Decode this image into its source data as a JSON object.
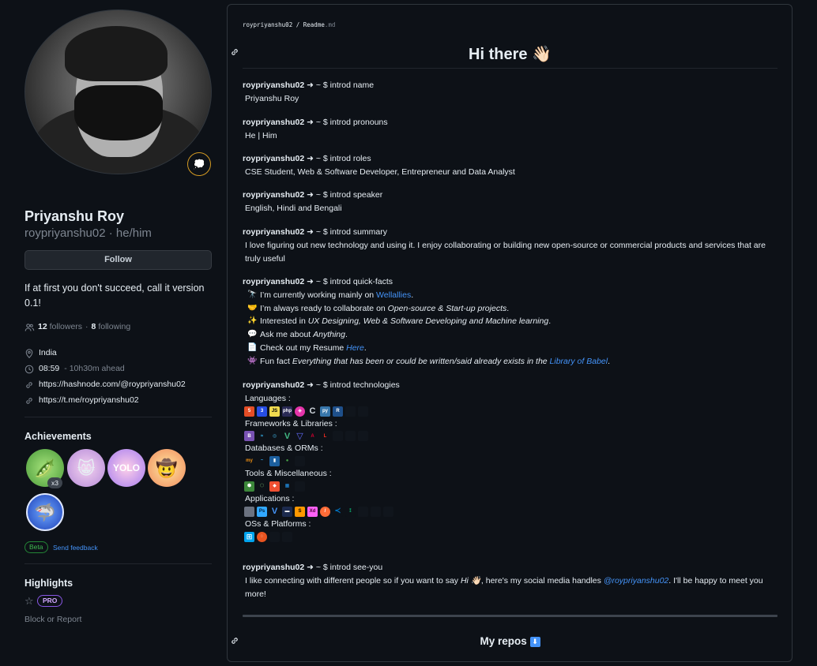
{
  "profile": {
    "name": "Priyanshu Roy",
    "login": "roypriyanshu02",
    "pronouns": "he/him",
    "login_line": "roypriyanshu02 · he/him",
    "follow_label": "Follow",
    "status_emoji": "💭",
    "bio": "If at first you don't succeed, call it version 0.1!",
    "followers_count": "12",
    "followers_label": "followers",
    "following_count": "8",
    "following_label": "following",
    "location": "India",
    "local_time": "08:59",
    "time_note": "- 10h30m ahead",
    "links": [
      "https://hashnode.com/@roypriyanshu02",
      "https://t.me/roypriyanshu02"
    ]
  },
  "achievements": {
    "title": "Achievements",
    "count_badge": "x3",
    "beta_label": "Beta",
    "feedback_label": "Send feedback",
    "badges": [
      "pair-extraordinaire",
      "quickdraw",
      "yolo",
      "starstruck",
      "pull-shark"
    ]
  },
  "highlights": {
    "title": "Highlights",
    "pro_label": "PRO",
    "block_label": "Block or Report"
  },
  "readme": {
    "breadcrumb_repo": "roypriyanshu02",
    "breadcrumb_sep": "/",
    "breadcrumb_file": "Readme",
    "breadcrumb_ext": ".md",
    "heading": "Hi there 👋🏻",
    "prompt_user": "roypriyanshu02",
    "prompt_rest": " ➜ ~ $ ",
    "cmd_name": "introd name",
    "out_name": "Priyanshu Roy",
    "cmd_pronouns": "introd pronouns",
    "out_pronouns": "He | Him",
    "cmd_roles": "introd roles",
    "out_roles": "CSE Student, Web & Software Developer, Entrepreneur and Data Analyst",
    "cmd_speaker": "introd speaker",
    "out_speaker": "English, Hindi and Bengali",
    "cmd_summary": "introd summary",
    "out_summary": "I love figuring out new technology and using it. I enjoy collaborating or building new open-source or commercial products and services that are truly useful",
    "cmd_facts": "introd quick-facts",
    "facts": [
      {
        "emoji": "🔭",
        "pre": "I’m currently working mainly on ",
        "link": "Wellallies",
        "em": "",
        "post": "."
      },
      {
        "emoji": "🤝",
        "pre": "I’m always ready to collaborate on ",
        "link": "",
        "em": "Open-source & Start-up projects",
        "post": "."
      },
      {
        "emoji": "✨",
        "pre": "Interested in ",
        "link": "",
        "em": "UX Designing, Web & Software Developing and Machine learning",
        "post": "."
      },
      {
        "emoji": "💬",
        "pre": "Ask me about ",
        "link": "",
        "em": "Anything",
        "post": "."
      },
      {
        "emoji": "📄",
        "pre": "Check out my Resume ",
        "link": "Here",
        "em": "",
        "post": "."
      },
      {
        "emoji": "👾",
        "pre": "Fun fact ",
        "link": "",
        "em": "Everything that has been or could be written/said already exists in the ",
        "post": "."
      }
    ],
    "fact_last_link": "Library of Babel",
    "cmd_tech": "introd technologies",
    "tech_categories": [
      "Languages :",
      "Frameworks & Libraries :",
      "Databases & ORMs :",
      "Tools & Miscellaneous :",
      "Applications :",
      "OSs & Platforms :"
    ],
    "cmd_seeyou": "introd see-you",
    "seeyou_pre": "I like connecting with different people so if you want to say ",
    "seeyou_hi": "Hi 👋🏻",
    "seeyou_mid": ", here's my social media handles ",
    "seeyou_link": "@roypriyanshu02",
    "seeyou_post": ". I'll be happy to meet you more!",
    "repos_heading": "My repos",
    "repos_emoji": "⬇"
  },
  "colors": {
    "background": "#0d1117",
    "link": "#4493f8",
    "muted": "#7d8590",
    "border": "#30363d"
  }
}
